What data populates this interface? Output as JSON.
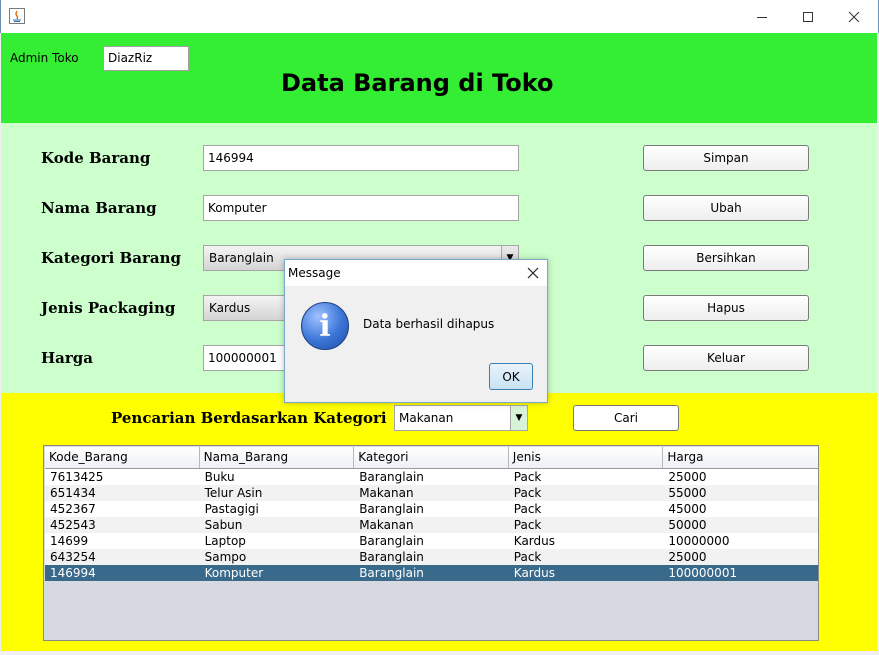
{
  "window": {
    "icon": "java-icon",
    "controls": [
      "minimize-icon",
      "maximize-icon",
      "close-icon"
    ]
  },
  "header": {
    "admin_label": "Admin Toko",
    "admin_value": "DiazRiz",
    "title": "Data Barang di Toko",
    "color": "#33ee33"
  },
  "form": {
    "kode_label": "Kode Barang",
    "kode_value": "146994",
    "nama_label": "Nama Barang",
    "nama_value": "Komputer",
    "kategori_label": "Kategori Barang",
    "kategori_value": "Baranglain",
    "jenis_label": "Jenis Packaging",
    "jenis_value": "Kardus",
    "harga_label": "Harga",
    "harga_value": "100000001"
  },
  "buttons": {
    "simpan": "Simpan",
    "ubah": "Ubah",
    "bersihkan": "Bersihkan",
    "hapus": "Hapus",
    "keluar": "Keluar"
  },
  "search": {
    "label": "Pencarian Berdasarkan Kategori",
    "value": "Makanan",
    "button": "Cari"
  },
  "table": {
    "columns": [
      "Kode_Barang",
      "Nama_Barang",
      "Kategori",
      "Jenis",
      "Harga"
    ],
    "rows": [
      [
        "7613425",
        "Buku",
        "Baranglain",
        "Pack",
        "25000"
      ],
      [
        "651434",
        "Telur Asin",
        "Makanan",
        "Pack",
        "55000"
      ],
      [
        "452367",
        "Pastagigi",
        "Baranglain",
        "Pack",
        "45000"
      ],
      [
        "452543",
        "Sabun",
        "Makanan",
        "Pack",
        "50000"
      ],
      [
        "14699",
        "Laptop",
        "Baranglain",
        "Kardus",
        "10000000"
      ],
      [
        "643254",
        "Sampo",
        "Baranglain",
        "Pack",
        "25000"
      ],
      [
        "146994",
        "Komputer",
        "Baranglain",
        "Kardus",
        "100000001"
      ]
    ],
    "selected_row": 6,
    "selected_color": "#39698b"
  },
  "dialog": {
    "title": "Message",
    "icon": "info-icon",
    "message": "Data berhasil dihapus",
    "ok": "OK"
  }
}
